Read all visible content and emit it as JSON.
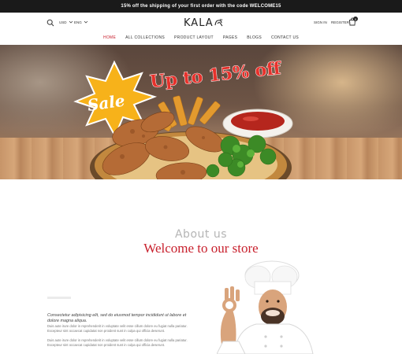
{
  "announcement": "15% off the shipping of your first order with the code WELCOME15",
  "header": {
    "currency": "USD",
    "language": "ENG",
    "logo_text": "KALA",
    "sign_in": "SIGN IN",
    "register": "REGISTER",
    "cart_count": "0"
  },
  "nav": {
    "items": [
      "HOME",
      "ALL COLLECTIONS",
      "PRODUCT LAYOUT",
      "PAGES",
      "BLOGS",
      "CONTACT US"
    ],
    "active": "HOME"
  },
  "banner": {
    "headline": "Up to 15% off",
    "badge": "Sale"
  },
  "about": {
    "heading": "About us",
    "subheading": "Welcome to our store",
    "lead": "Consectetur adipisicing elit, sed do eiusmod tempor incididunt ut labore et dolore magna aliqua.",
    "paragraphs": [
      "Duis aute irure dolor in reprehenderit in voluptate velit esse cillum dolore eu fugiat nulla pariatur. Excepteur sint occaecat cupidatat non proident sunt in culpa qui officia deserunt.",
      "Duis aute irure dolor in reprehenderit in voluptate velit esse cillum dolore eu fugiat nulla pariatur. Excepteur sint occaecat cupidatat non proident sunt in culpa qui officia deserunt."
    ]
  },
  "icons": [
    "search-icon",
    "chevron-down-icon",
    "cart-icon"
  ],
  "colors": {
    "accent": "#c8202d",
    "topbar": "#1a1a1a"
  }
}
